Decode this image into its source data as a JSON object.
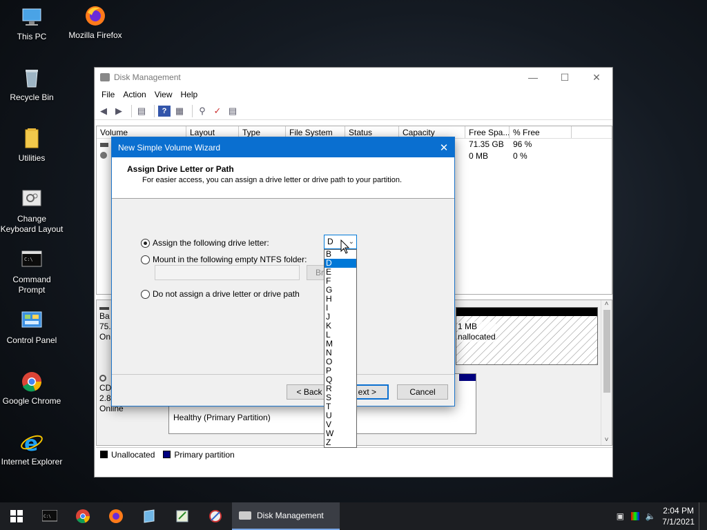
{
  "desktop": {
    "icons": [
      {
        "label": "This PC"
      },
      {
        "label": "Mozilla Firefox"
      },
      {
        "label": "Recycle Bin"
      },
      {
        "label": "Utilities"
      },
      {
        "label": "Change Keyboard Layout"
      },
      {
        "label": "Command Prompt"
      },
      {
        "label": "Control Panel"
      },
      {
        "label": "Google Chrome"
      },
      {
        "label": "Internet Explorer"
      }
    ]
  },
  "disk_management": {
    "title": "Disk Management",
    "menu": [
      "File",
      "Action",
      "View",
      "Help"
    ],
    "columns": [
      "Volume",
      "Layout",
      "Type",
      "File System",
      "Status",
      "Capacity",
      "Free Spa...",
      "% Free"
    ],
    "rows": [
      {
        "volume": "",
        "free": "71.35 GB",
        "pct": "96 %"
      },
      {
        "volume": "",
        "free": "0 MB",
        "pct": "0 %"
      }
    ],
    "disk0": {
      "label1": "Ba",
      "label2": "75.",
      "label3": "On",
      "unalloc_size": "1 MB",
      "unalloc_text": "nallocated"
    },
    "cdrom": {
      "label1": "CD",
      "label2": "2.8",
      "label3": "Online",
      "partition": "Healthy (Primary Partition)"
    },
    "legend": [
      {
        "label": "Unallocated",
        "color": "#000000"
      },
      {
        "label": "Primary partition",
        "color": "#00007f"
      }
    ]
  },
  "wizard": {
    "title": "New Simple Volume Wizard",
    "heading": "Assign Drive Letter or Path",
    "subheading": "For easier access, you can assign a drive letter or drive path to your partition.",
    "opt_assign": "Assign the following drive letter:",
    "opt_mount": "Mount in the following empty NTFS folder:",
    "opt_none": "Do not assign a drive letter or drive path",
    "browse": "Br",
    "back": "< Back",
    "next": "ext >",
    "cancel": "Cancel",
    "selected_letter": "D",
    "letters": [
      "B",
      "D",
      "E",
      "F",
      "G",
      "H",
      "I",
      "J",
      "K",
      "L",
      "M",
      "N",
      "O",
      "P",
      "Q",
      "R",
      "S",
      "T",
      "U",
      "V",
      "W",
      "Z"
    ]
  },
  "taskbar": {
    "active_app": "Disk Management",
    "time": "2:04 PM",
    "date": "7/1/2021"
  }
}
